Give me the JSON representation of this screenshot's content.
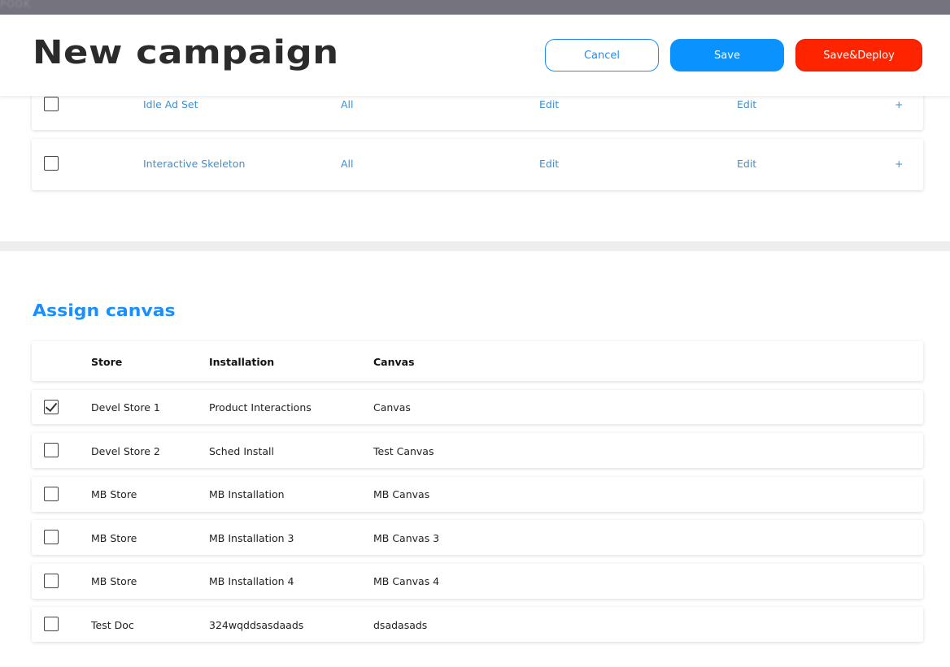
{
  "topbar": {
    "text": "POOK"
  },
  "header": {
    "title": "New campaign",
    "cancel_label": "Cancel",
    "save_label": "Save",
    "deploy_label": "Save&Deploy"
  },
  "ad_rows": [
    {
      "name": "Idle Ad Set",
      "audience": "All",
      "col3": "Edit",
      "col4": "Edit",
      "add": "+"
    },
    {
      "name": "Interactive Skeleton",
      "audience": "All",
      "col3": "Edit",
      "col4": "Edit",
      "add": "+"
    }
  ],
  "assign_canvas": {
    "title": "Assign canvas",
    "headers": {
      "store": "Store",
      "installation": "Installation",
      "canvas": "Canvas"
    },
    "rows": [
      {
        "checked": true,
        "store": "Devel Store 1",
        "installation": "Product Interactions",
        "canvas": "Canvas"
      },
      {
        "checked": false,
        "store": "Devel Store 2",
        "installation": "Sched Install",
        "canvas": "Test Canvas"
      },
      {
        "checked": false,
        "store": "MB Store",
        "installation": "MB Installation",
        "canvas": "MB Canvas"
      },
      {
        "checked": false,
        "store": "MB Store",
        "installation": "MB Installation 3",
        "canvas": "MB Canvas 3"
      },
      {
        "checked": false,
        "store": "MB Store",
        "installation": "MB Installation 4",
        "canvas": "MB Canvas 4"
      },
      {
        "checked": false,
        "store": "Test Doc",
        "installation": "324wqddsasdaads",
        "canvas": "dsadasads"
      }
    ]
  },
  "colors": {
    "accent": "#0a93ff",
    "danger": "#ff2400",
    "link": "#3f8fd0",
    "title": "#2b2b2b"
  }
}
